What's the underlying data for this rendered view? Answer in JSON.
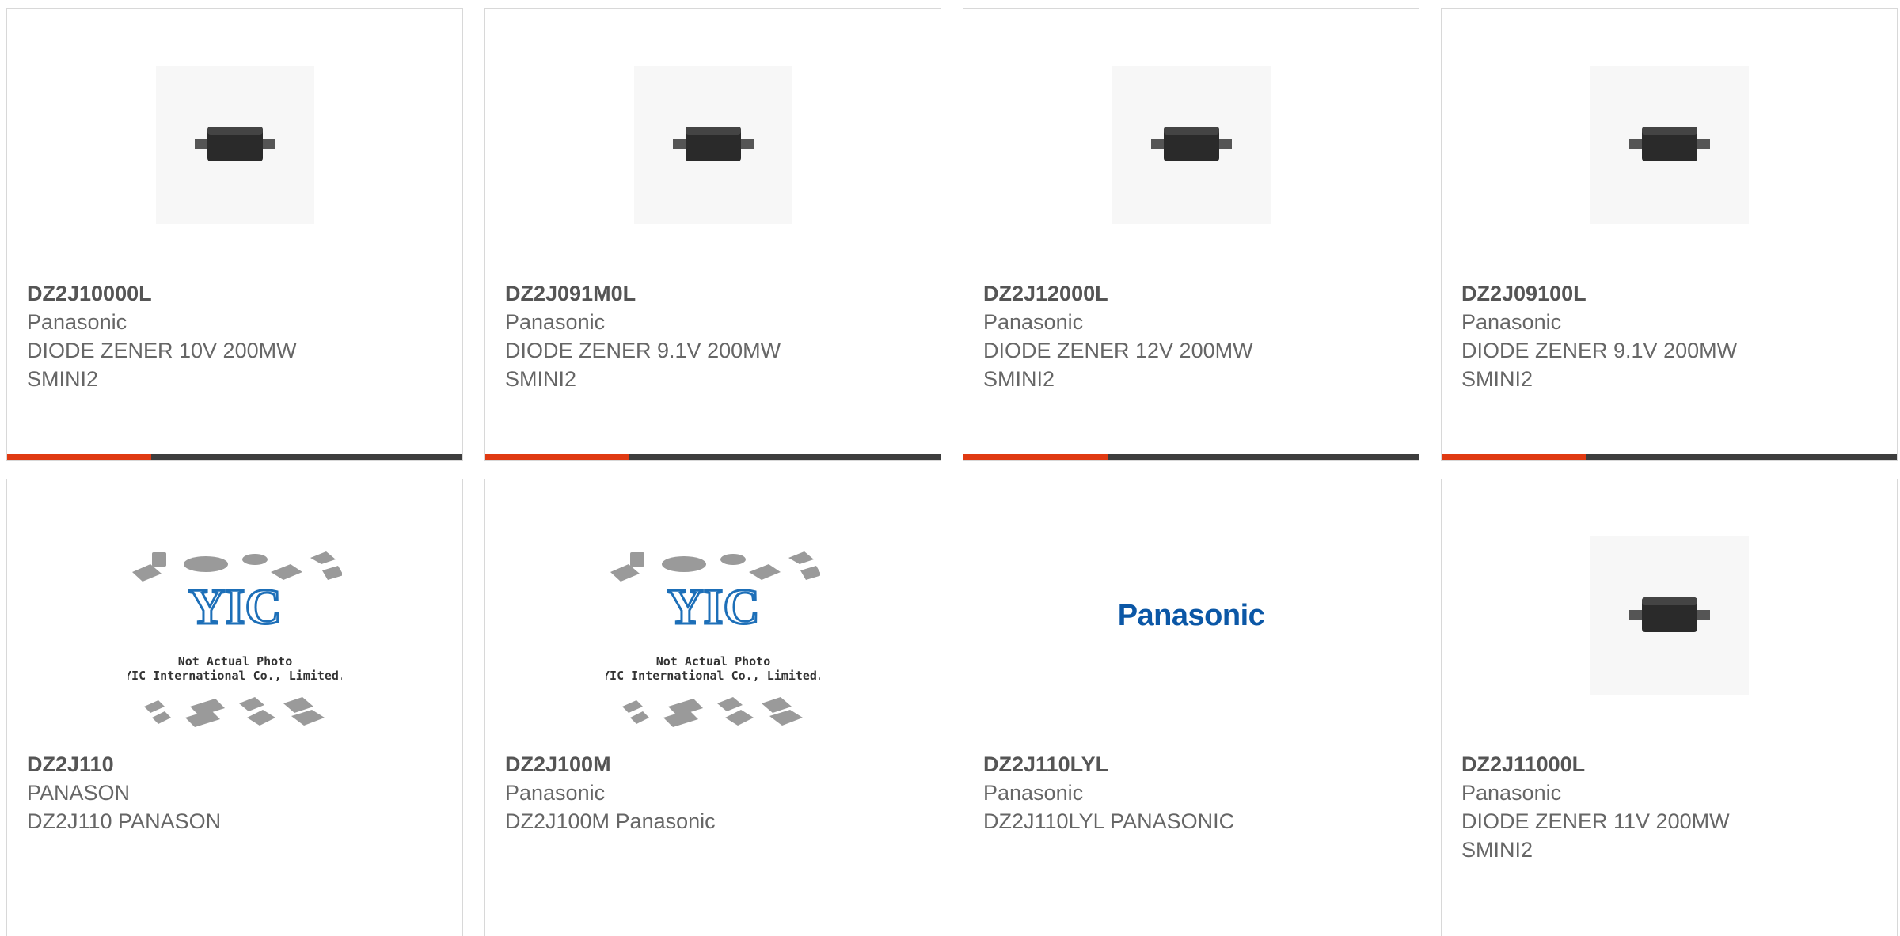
{
  "products": [
    {
      "part": "DZ2J10000L",
      "brand": "Panasonic",
      "desc": "DIODE ZENER 10V 200MW",
      "package": "SMINI2",
      "image": "diode-photo"
    },
    {
      "part": "DZ2J091M0L",
      "brand": "Panasonic",
      "desc": "DIODE ZENER 9.1V 200MW",
      "package": "SMINI2",
      "image": "diode-photo"
    },
    {
      "part": "DZ2J12000L",
      "brand": "Panasonic",
      "desc": "DIODE ZENER 12V 200MW",
      "package": "SMINI2",
      "image": "diode-photo"
    },
    {
      "part": "DZ2J09100L",
      "brand": "Panasonic",
      "desc": "DIODE ZENER 9.1V 200MW",
      "package": "SMINI2",
      "image": "diode-photo"
    },
    {
      "part": "DZ2J110",
      "brand": "PANASON",
      "desc": "DZ2J110 PANASON",
      "package": "",
      "image": "yic-placeholder"
    },
    {
      "part": "DZ2J100M",
      "brand": "Panasonic",
      "desc": "DZ2J100M Panasonic",
      "package": "",
      "image": "yic-placeholder"
    },
    {
      "part": "DZ2J110LYL",
      "brand": "Panasonic",
      "desc": "DZ2J110LYL PANASONIC",
      "package": "",
      "image": "panasonic-logo"
    },
    {
      "part": "DZ2J11000L",
      "brand": "Panasonic",
      "desc": "DIODE ZENER 11V 200MW",
      "package": "SMINI2",
      "image": "diode-photo"
    }
  ],
  "placeholder": {
    "line1": "Not Actual Photo",
    "line2": "YIC International Co., Limited.",
    "logo": "YIC"
  },
  "logo_text": "Panasonic",
  "colors": {
    "accent": "#e03a12",
    "bar": "#3d3d3d",
    "border": "#d8d8d8",
    "text": "#666666"
  }
}
